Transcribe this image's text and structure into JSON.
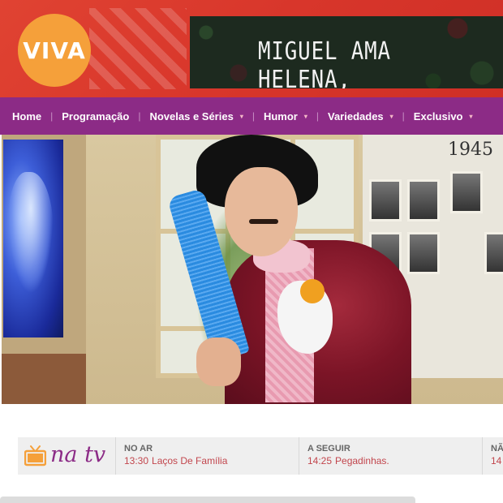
{
  "header": {
    "logo_text": "VIVA",
    "banner_text": "MIGUEL AMA HELENA,"
  },
  "nav": {
    "items": [
      {
        "label": "Home",
        "has_dropdown": false
      },
      {
        "label": "Programação",
        "has_dropdown": false
      },
      {
        "label": "Novelas e Séries",
        "has_dropdown": true
      },
      {
        "label": "Humor",
        "has_dropdown": true
      },
      {
        "label": "Variedades",
        "has_dropdown": true
      },
      {
        "label": "Exclusivo",
        "has_dropdown": true
      }
    ],
    "caret": "▾"
  },
  "hero": {
    "wall_year": "1945"
  },
  "natv": {
    "label": "na tv",
    "slots": [
      {
        "label": "NO AR",
        "time": "13:30",
        "program": "Laços De Família"
      },
      {
        "label": "A SEGUIR",
        "time": "14:25",
        "program": "Pegadinhas."
      },
      {
        "label": "NÃ",
        "time": "14",
        "program": ""
      }
    ]
  },
  "colors": {
    "header_red": "#d8362b",
    "logo_orange": "#f5a03a",
    "nav_purple": "#8c2b86",
    "program_red": "#c2464d",
    "tv_icon_orange": "#f5a03a"
  },
  "icons": {
    "tv": "tv-icon",
    "dropdown": "chevron-down-icon"
  }
}
